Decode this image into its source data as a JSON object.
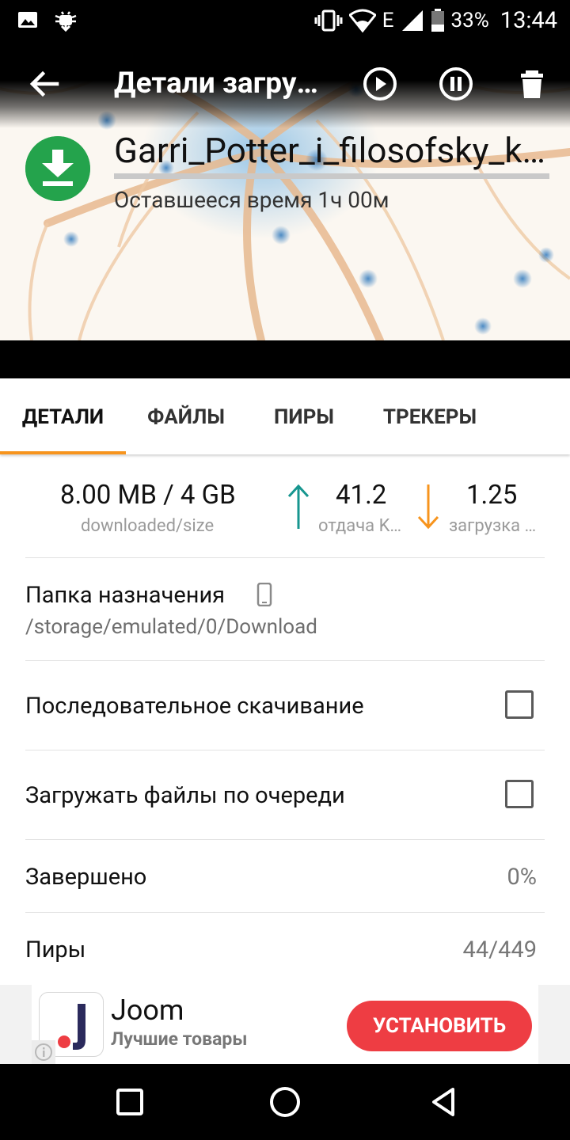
{
  "status_bar": {
    "battery": "33%",
    "network": "E",
    "time": "13:44",
    "icons": [
      "image-icon",
      "android-debug-icon",
      "vibrate-icon",
      "wifi-icon",
      "signal-icon",
      "battery-icon"
    ]
  },
  "toolbar": {
    "title": "Детали загрузки",
    "icons": [
      "back-arrow-icon",
      "play-icon",
      "pause-icon",
      "trash-icon"
    ]
  },
  "torrent": {
    "name": "Garri_Potter_i_filosofsky_kamen",
    "remaining": "Оставшееся время 1ч 00м",
    "progress": 0.0
  },
  "tabs": {
    "items": [
      "ДЕТАЛИ",
      "ФАЙЛЫ",
      "ПИРЫ",
      "ТРЕКЕРЫ"
    ],
    "active": 0
  },
  "stats": {
    "size_value": "8.00 MB / 4 GB",
    "size_label": "downloaded/size",
    "upload_value": "41.2",
    "upload_label": "отдача KB/s",
    "download_value": "1.25",
    "download_label": "загрузка MB/s",
    "upload_color": "#17968f",
    "download_color": "#f7941d"
  },
  "folder": {
    "label": "Папка назначения",
    "path": "/storage/emulated/0/Download"
  },
  "options": {
    "sequential_label": "Последовательное скачивание",
    "sequential_checked": false,
    "queue_label": "Загружать файлы по очереди",
    "queue_checked": false
  },
  "info": {
    "completed_label": "Завершено",
    "completed_value": "0%",
    "peers_label": "Пиры",
    "peers_value": "44/449"
  },
  "ad": {
    "title": "Joom",
    "subtitle": "Лучшие товары",
    "button": "УСТАНОВИТЬ"
  },
  "colors": {
    "accent": "#f7941d",
    "download_badge": "#24a34c",
    "ad_button": "#ee3d43"
  }
}
